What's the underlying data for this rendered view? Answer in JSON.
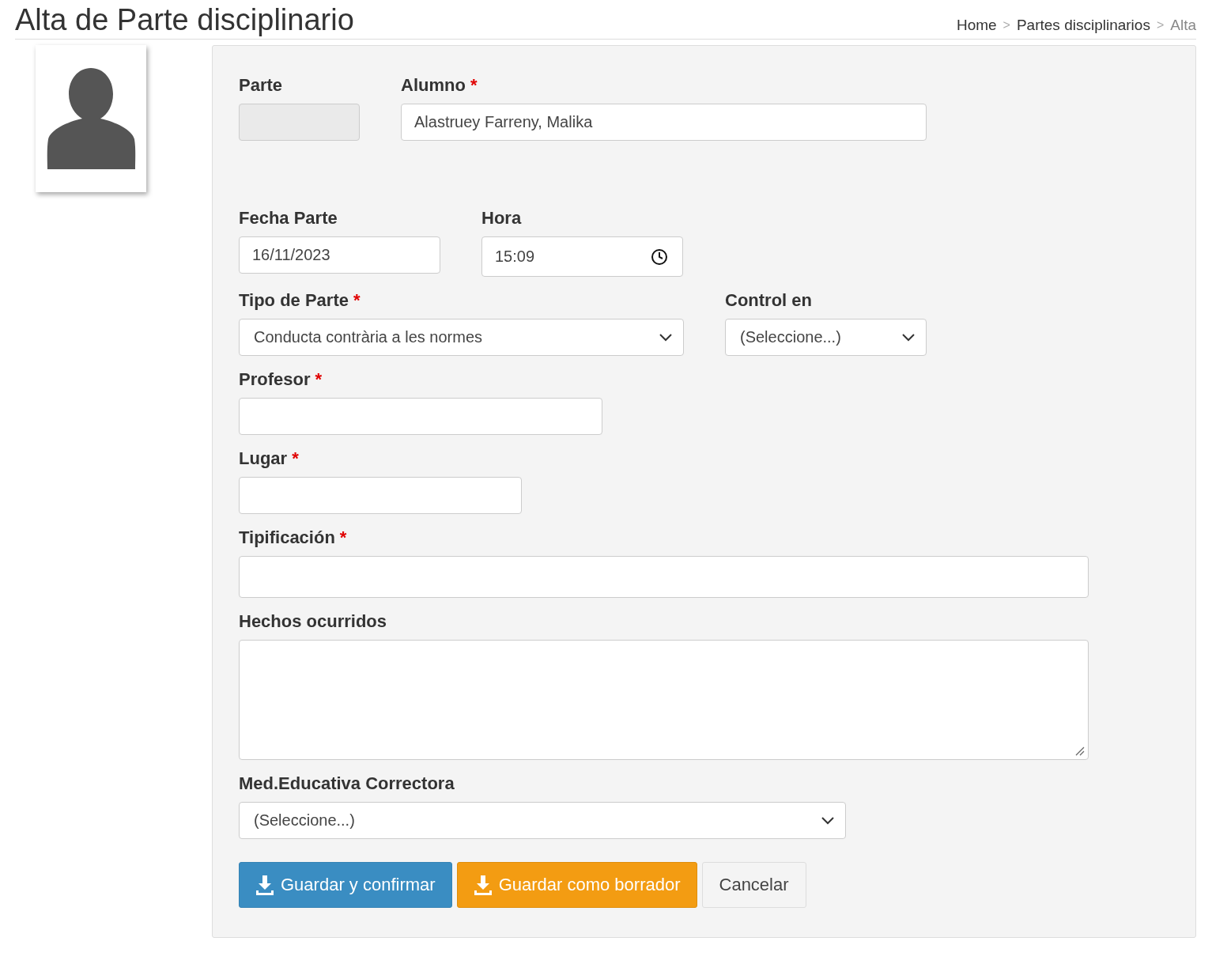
{
  "page_title": "Alta de Parte disciplinario",
  "breadcrumb": [
    {
      "label": "Home",
      "separator": ">"
    },
    {
      "label": "Partes disciplinarios",
      "separator": ">"
    },
    {
      "label": "Alta"
    }
  ],
  "form": {
    "rows": [
      [
        {
          "label": "Parte",
          "kind": "disabled"
        },
        {
          "label": "Alumno",
          "required_mark": "*",
          "kind": "text",
          "value": "Alastruey Farreny, Malika"
        }
      ],
      [
        {
          "label": "Fecha Parte",
          "kind": "text",
          "value": "16/11/2023"
        },
        {
          "label": "Hora",
          "kind": "time",
          "value": "15:09"
        }
      ],
      [
        {
          "label": "Tipo de Parte",
          "required_mark": "*",
          "kind": "select",
          "value": "Conducta contrària a les normes"
        },
        {
          "label": "Control en",
          "kind": "select",
          "value": "(Seleccione...)"
        }
      ],
      [
        {
          "label": "Profesor",
          "required_mark": "*",
          "kind": "text"
        }
      ],
      [
        {
          "label": "Lugar",
          "required_mark": "*",
          "kind": "text"
        }
      ],
      [
        {
          "label": "Tipificación",
          "required_mark": "*",
          "kind": "text"
        }
      ],
      [
        {
          "label": "Hechos ocurridos",
          "kind": "textarea"
        }
      ],
      [
        {
          "label": "Med.Educativa Correctora",
          "kind": "select",
          "value": "(Seleccione...)"
        }
      ]
    ],
    "buttons": [
      {
        "label": "Guardar y confirmar",
        "kind": "primary"
      },
      {
        "label": "Guardar como borrador",
        "kind": "warning"
      },
      {
        "label": "Cancelar",
        "kind": "default"
      }
    ]
  }
}
